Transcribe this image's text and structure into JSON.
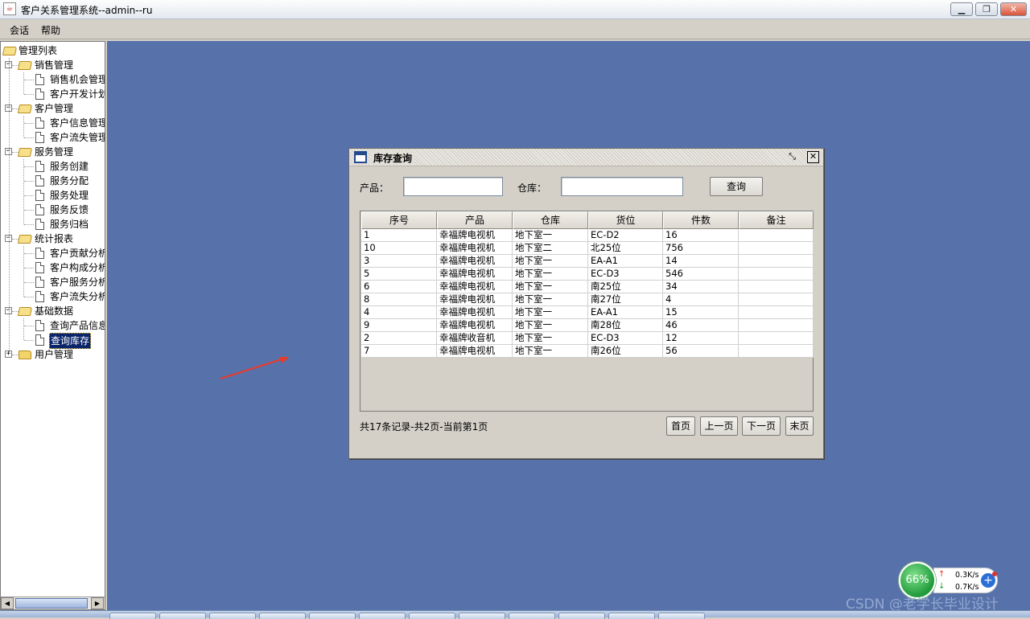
{
  "window": {
    "title": "客户关系管理系统--admin--ru",
    "minimize_icon": "minimize-icon",
    "restore_icon": "restore-icon",
    "close_icon": "close-icon"
  },
  "menubar": {
    "items": [
      "会话",
      "帮助"
    ]
  },
  "tree": {
    "root": "管理列表",
    "groups": [
      {
        "label": "销售管理",
        "expanded": true,
        "children": [
          "销售机会管理",
          "客户开发计划"
        ]
      },
      {
        "label": "客户管理",
        "expanded": true,
        "children": [
          "客户信息管理",
          "客户流失管理"
        ]
      },
      {
        "label": "服务管理",
        "expanded": true,
        "children": [
          "服务创建",
          "服务分配",
          "服务处理",
          "服务反馈",
          "服务归档"
        ]
      },
      {
        "label": "统计报表",
        "expanded": true,
        "children": [
          "客户贡献分析",
          "客户构成分析",
          "客户服务分析",
          "客户流失分析"
        ]
      },
      {
        "label": "基础数据",
        "expanded": true,
        "children": [
          "查询产品信息",
          "查询库存"
        ]
      },
      {
        "label": "用户管理",
        "expanded": false,
        "children": []
      }
    ],
    "selected": "查询库存",
    "toggle_expanded": "−",
    "toggle_collapsed": "+"
  },
  "inventory_frame": {
    "title": "库存查询",
    "product_label": "产品：",
    "product_value": "",
    "warehouse_label": "仓库：",
    "warehouse_value": "",
    "query_button": "查询",
    "columns": [
      "序号",
      "产品",
      "仓库",
      "货位",
      "件数",
      "备注"
    ],
    "rows": [
      [
        "1",
        "幸福牌电视机",
        "地下室一",
        "EC-D2",
        "16",
        ""
      ],
      [
        "10",
        "幸福牌电视机",
        "地下室二",
        "北25位",
        "756",
        ""
      ],
      [
        "3",
        "幸福牌电视机",
        "地下室一",
        "EA-A1",
        "14",
        ""
      ],
      [
        "5",
        "幸福牌电视机",
        "地下室一",
        "EC-D3",
        "546",
        ""
      ],
      [
        "6",
        "幸福牌电视机",
        "地下室一",
        "南25位",
        "34",
        ""
      ],
      [
        "8",
        "幸福牌电视机",
        "地下室一",
        "南27位",
        "4",
        ""
      ],
      [
        "4",
        "幸福牌电视机",
        "地下室一",
        "EA-A1",
        "15",
        ""
      ],
      [
        "9",
        "幸福牌电视机",
        "地下室一",
        "南28位",
        "46",
        ""
      ],
      [
        "2",
        "幸福牌收音机",
        "地下室一",
        "EC-D3",
        "12",
        ""
      ],
      [
        "7",
        "幸福牌电视机",
        "地下室一",
        "南26位",
        "56",
        ""
      ]
    ],
    "status": "共17条记录-共2页-当前第1页",
    "pager": {
      "first": "首页",
      "prev": "上一页",
      "next": "下一页",
      "last": "末页"
    }
  },
  "net_widget": {
    "percent": "66%",
    "up": "0.3K/s",
    "down": "0.7K/s"
  },
  "watermark": "CSDN @老学长毕业设计",
  "colors": {
    "desktop": "#5772aa",
    "selection": "#0a246a",
    "panel": "#d4d0c8"
  }
}
